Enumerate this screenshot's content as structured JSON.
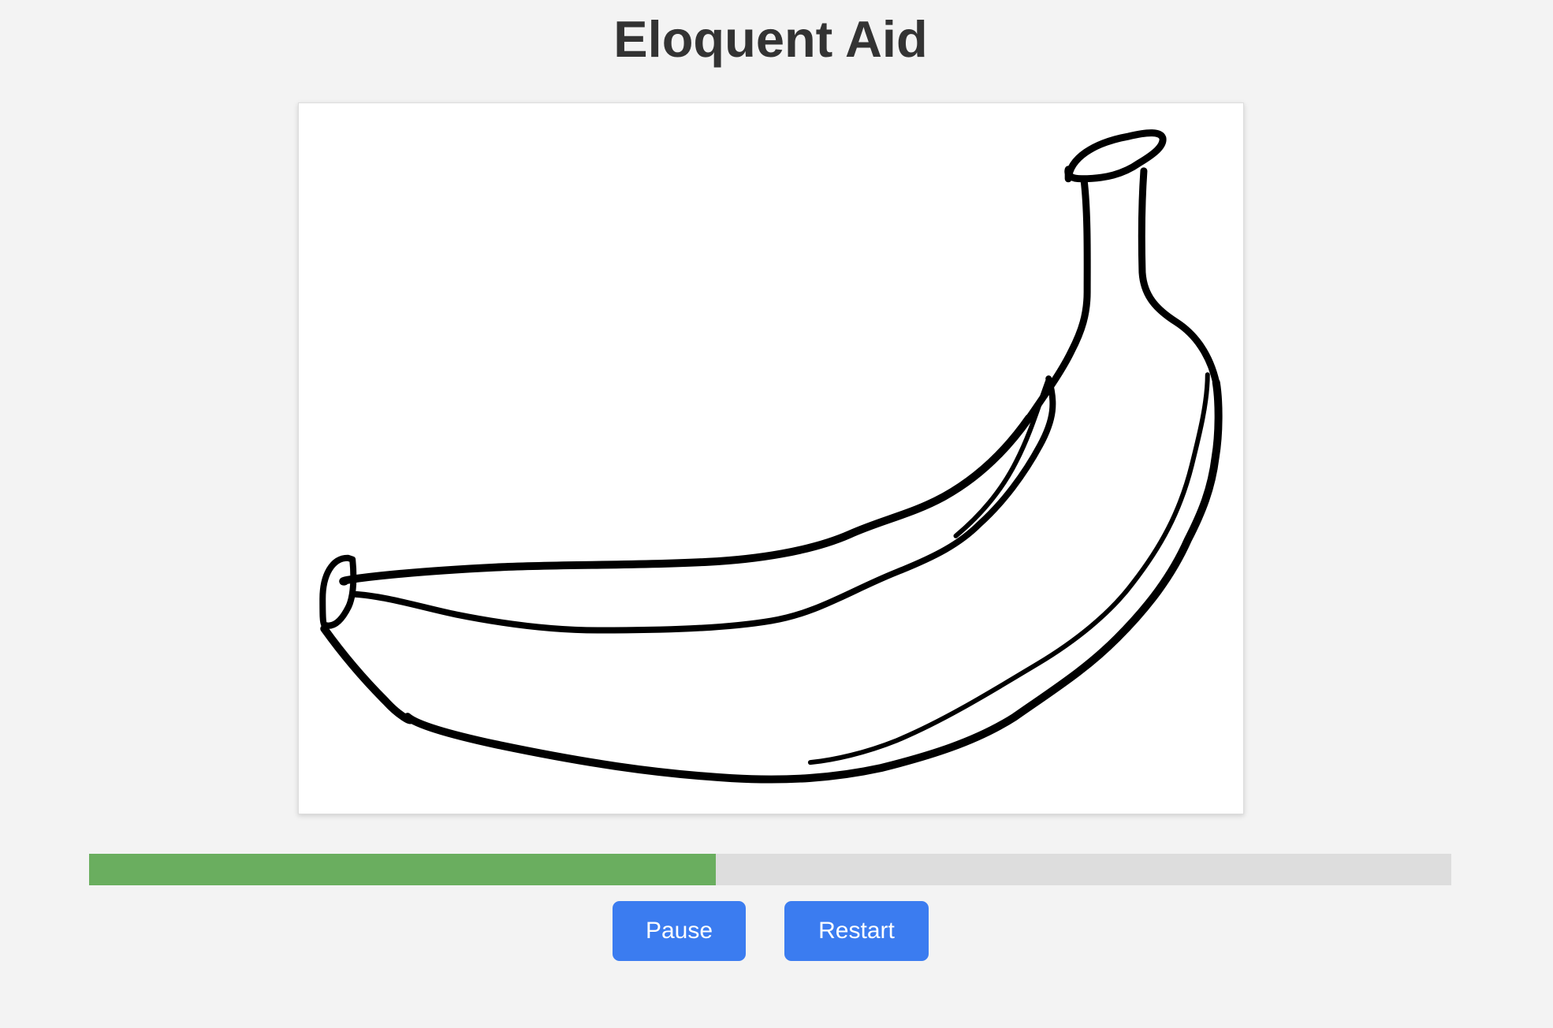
{
  "app": {
    "title": "Eloquent Aid"
  },
  "drawing": {
    "subject": "banana",
    "stroke_color": "#000000",
    "background_color": "#ffffff"
  },
  "progress": {
    "fraction": 0.46,
    "fill_color": "#6aae5f",
    "track_color": "#dddddd"
  },
  "controls": {
    "pause_label": "Pause",
    "restart_label": "Restart",
    "button_color": "#3b7cf0"
  }
}
